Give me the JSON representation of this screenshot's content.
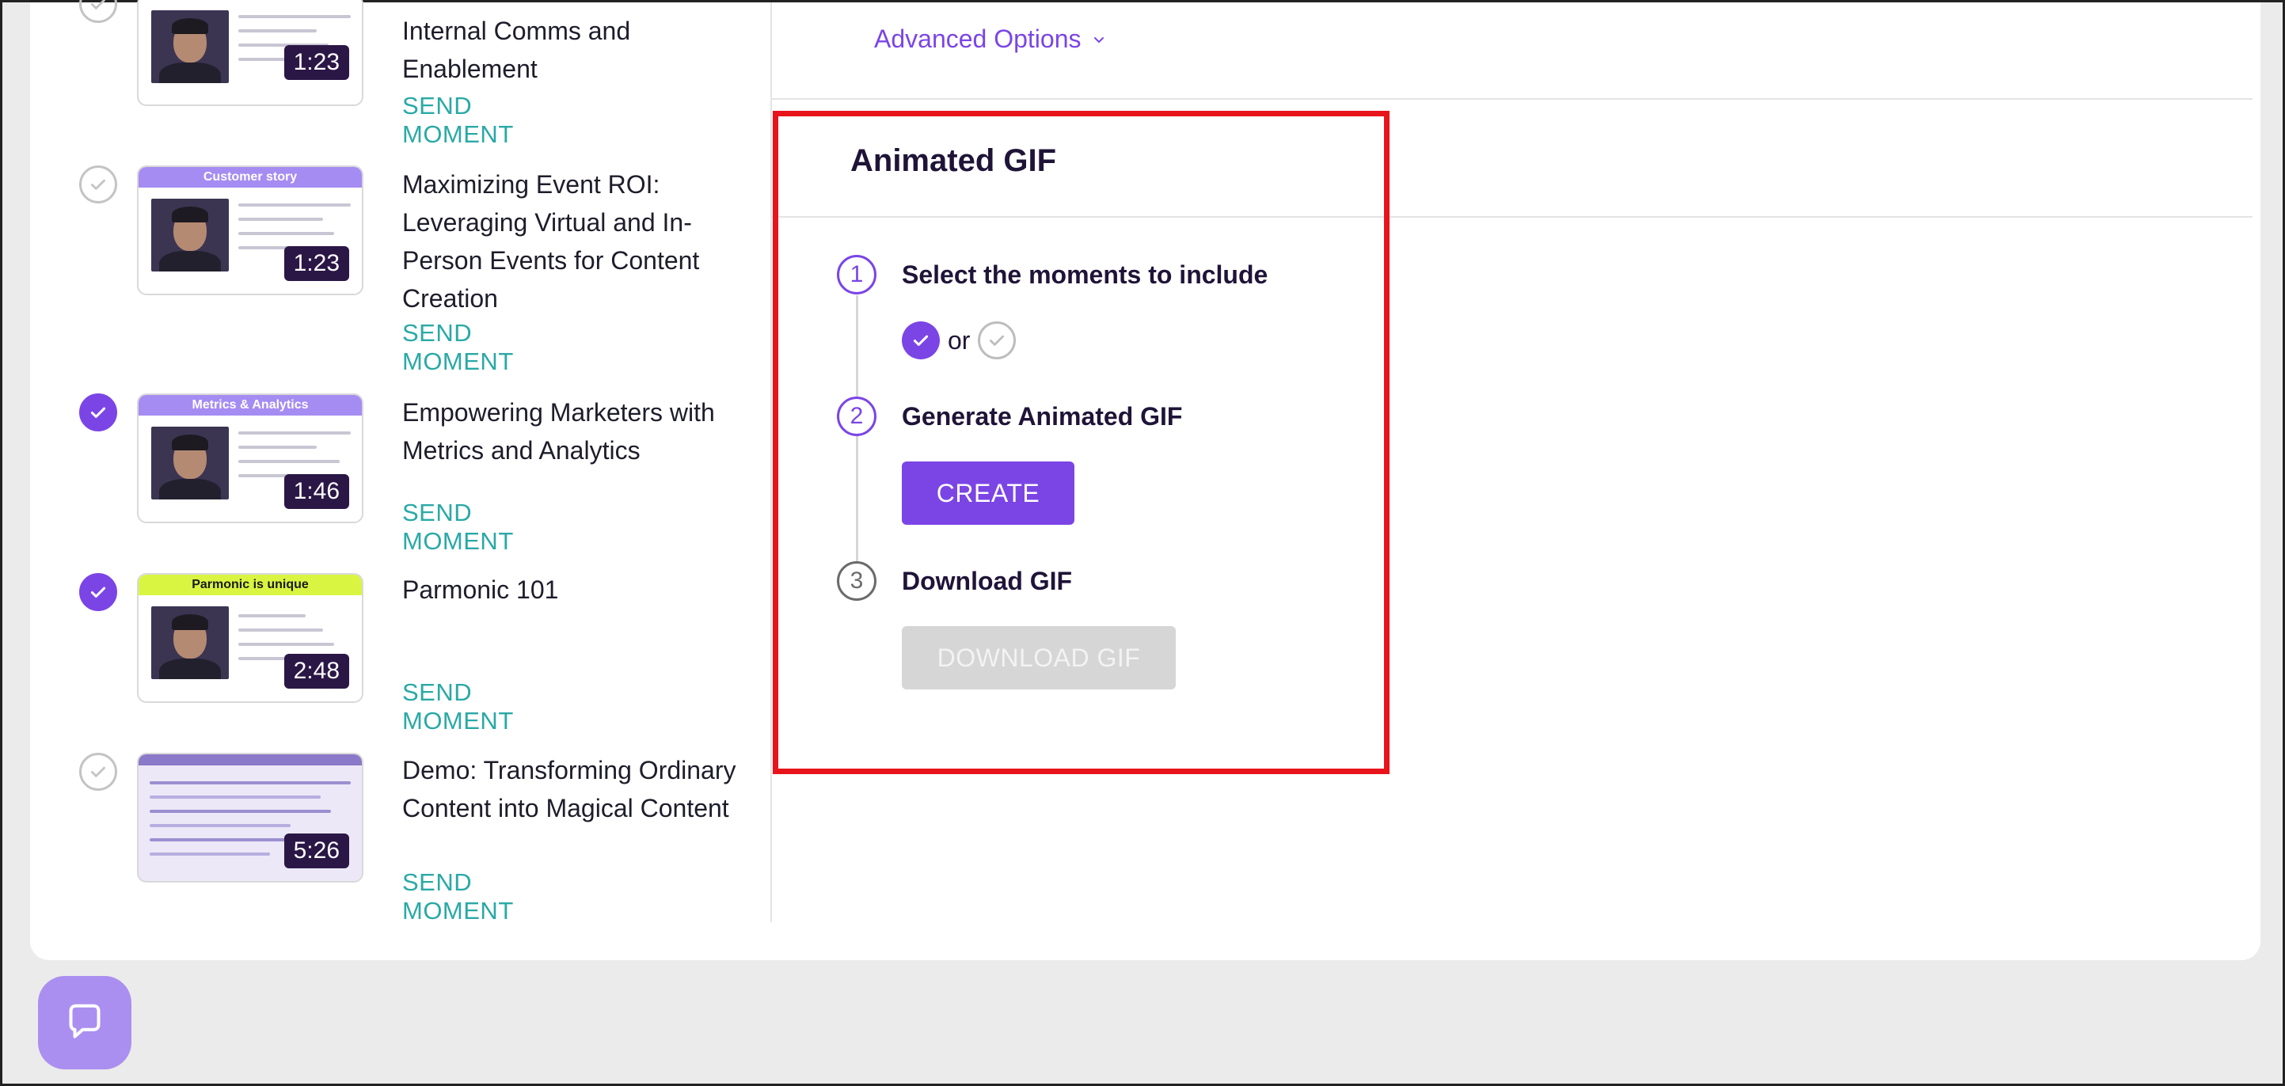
{
  "moments": [
    {
      "title": "Internal Comms and Enablement",
      "duration": "1:23",
      "checked": false,
      "send_label": "SEND MOMENT",
      "thumb_band": "",
      "thumb_color": "#ffffff"
    },
    {
      "title": "Maximizing Event ROI: Leveraging Virtual and In-Person Events for Content Creation",
      "duration": "1:23",
      "checked": false,
      "send_label": "SEND MOMENT",
      "thumb_band": "Customer story",
      "thumb_color": "#a58cf2"
    },
    {
      "title": "Empowering Marketers with Metrics and Analytics",
      "duration": "1:46",
      "checked": true,
      "send_label": "SEND MOMENT",
      "thumb_band": "Metrics & Analytics",
      "thumb_color": "#a58cf2"
    },
    {
      "title": "Parmonic 101",
      "duration": "2:48",
      "checked": true,
      "send_label": "SEND MOMENT",
      "thumb_band": "Parmonic is unique",
      "thumb_color": "#d9f542"
    },
    {
      "title": "Demo: Transforming Ordinary Content into Magical Content",
      "duration": "5:26",
      "checked": false,
      "send_label": "SEND MOMENT",
      "thumb_band": "",
      "thumb_color": "#8a78c9"
    }
  ],
  "advanced_options": {
    "label": "Advanced Options",
    "icon": "chevron-down-icon"
  },
  "gif_panel": {
    "title": "Animated GIF",
    "steps": [
      {
        "number": "1",
        "label": "Select the moments to include"
      },
      {
        "number": "2",
        "label": "Generate Animated GIF"
      },
      {
        "number": "3",
        "label": "Download GIF"
      }
    ],
    "or_text": "or",
    "create_label": "CREATE",
    "download_label": "DOWNLOAD GIF"
  },
  "colors": {
    "accent": "#7b45e6",
    "send_link": "#2aa9a6",
    "highlight": "#e8141c",
    "disabled": "#d6d6d6"
  },
  "chat": {
    "icon": "chat-bubble-icon"
  }
}
